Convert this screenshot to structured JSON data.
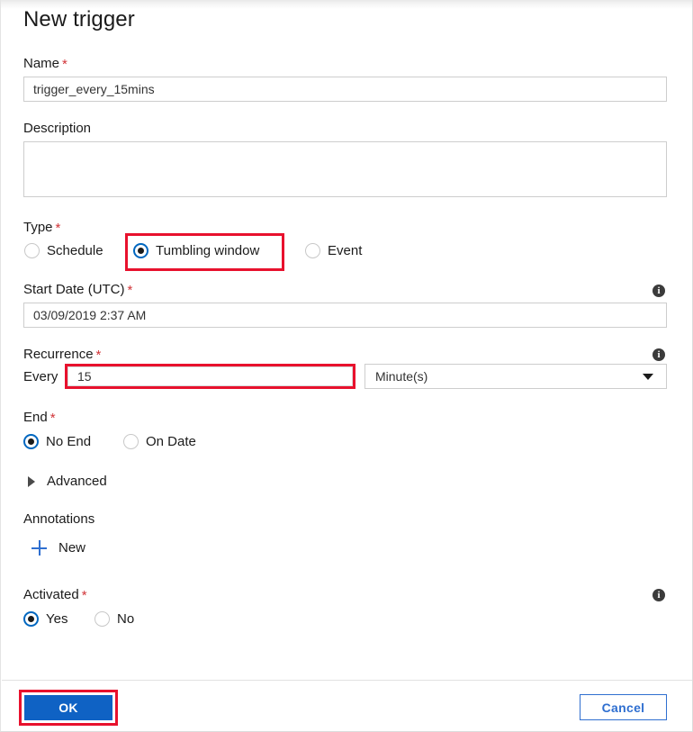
{
  "dialog": {
    "title": "New trigger"
  },
  "fields": {
    "name": {
      "label": "Name",
      "required": "*",
      "value": "trigger_every_15mins",
      "placeholder": "Name"
    },
    "description": {
      "label": "Description",
      "value": "",
      "placeholder": ""
    },
    "type": {
      "label": "Type",
      "required": "*",
      "options": [
        {
          "label": "Schedule",
          "selected": false
        },
        {
          "label": "Tumbling window",
          "selected": true
        },
        {
          "label": "Event",
          "selected": false
        }
      ],
      "highlighted_option": "Tumbling window"
    },
    "start_date": {
      "label": "Start Date (UTC)",
      "required": "*",
      "value": "03/09/2019 2:37 AM",
      "info_icon": "info-icon"
    },
    "recurrence": {
      "label": "Recurrence",
      "required": "*",
      "every_label": "Every",
      "every_value": "15",
      "unit_selected": "Minute(s)",
      "info_icon": "info-icon"
    },
    "end": {
      "label": "End",
      "required": "*",
      "options": [
        {
          "label": "No End",
          "selected": true
        },
        {
          "label": "On Date",
          "selected": false
        }
      ]
    },
    "advanced": {
      "label": "Advanced",
      "expanded": false,
      "chevron_icon": "chevron-right-icon"
    },
    "annotations": {
      "label": "Annotations",
      "new_label": "New",
      "plus_icon": "plus-icon"
    },
    "activated": {
      "label": "Activated",
      "required": "*",
      "options": [
        {
          "label": "Yes",
          "selected": true
        },
        {
          "label": "No",
          "selected": false
        }
      ],
      "info_icon": "info-icon"
    }
  },
  "footer": {
    "ok_label": "OK",
    "cancel_label": "Cancel"
  },
  "colors": {
    "accent_blue": "#0f62c4",
    "link_blue": "#2f6fd0",
    "radio_blue": "#0067c0",
    "required_red": "#d13438",
    "highlight_red": "#e8112d",
    "text": "#1b1b1b",
    "border": "#cdcdcd"
  }
}
